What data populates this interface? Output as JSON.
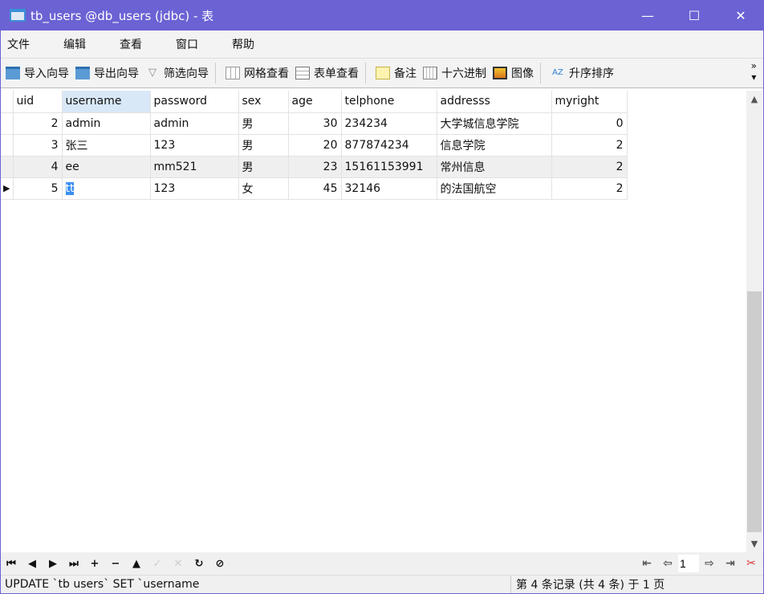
{
  "window": {
    "title": "tb_users @db_users (jdbc) - 表",
    "minimize": "—",
    "maximize": "☐",
    "close": "✕"
  },
  "menu": [
    "文件",
    "编辑",
    "查看",
    "窗口",
    "帮助"
  ],
  "toolbar": {
    "import": "导入向导",
    "export": "导出向导",
    "filter": "筛选向导",
    "grid_view": "网格查看",
    "form_view": "表单查看",
    "memo": "备注",
    "hex": "十六进制",
    "image": "图像",
    "sort": "升序排序",
    "more": "»"
  },
  "table": {
    "columns": [
      "uid",
      "username",
      "password",
      "sex",
      "age",
      "telphone",
      "addresss",
      "myright"
    ],
    "rows": [
      [
        "2",
        "admin",
        "admin",
        "男",
        "30",
        "234234",
        "大学城信息学院",
        "0"
      ],
      [
        "3",
        "张三",
        "123",
        "男",
        "20",
        "877874234",
        "信息学院",
        "2"
      ],
      [
        "4",
        "ee",
        "mm521",
        "男",
        "23",
        "15161153991",
        "常州信息",
        "2"
      ],
      [
        "5",
        "tt",
        "123",
        "女",
        "45",
        "32146",
        "的法国航空",
        "2"
      ]
    ]
  },
  "pager": {
    "page": "1"
  },
  "status": {
    "sql": "UPDATE `tb users` SET `username",
    "record": "第 4 条记录 (共 4 条) 于 1 页"
  },
  "colors": {
    "titlebar": "#6b62d4",
    "selection": "#3b8ff0",
    "header_selected": "#d9e8f7"
  }
}
